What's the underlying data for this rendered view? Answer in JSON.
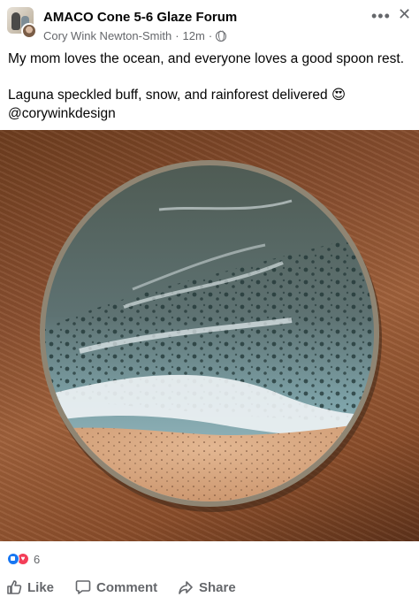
{
  "post": {
    "group_name": "AMACO Cone 5-6 Glaze Forum",
    "author": "Cory Wink Newton-Smith",
    "time": "12m",
    "separator": "·",
    "line1": "My mom loves the ocean, and everyone loves a good spoon rest.",
    "line2": "Laguna speckled buff, snow, and rainforest delivered 😍",
    "line3": "@corywinkdesign"
  },
  "reactions": {
    "count": "6"
  },
  "actions": {
    "like": "Like",
    "comment": "Comment",
    "share": "Share"
  },
  "icons": {
    "more": "more-horizontal-icon",
    "close": "close-icon",
    "audience": "globe-icon",
    "like": "thumbs-up-icon",
    "comment": "comment-bubble-icon",
    "share": "share-arrow-icon"
  },
  "colors": {
    "text": "#050505",
    "secondary": "#65676b",
    "like_blue": "#1877f2",
    "love_red": "#f33e58"
  }
}
